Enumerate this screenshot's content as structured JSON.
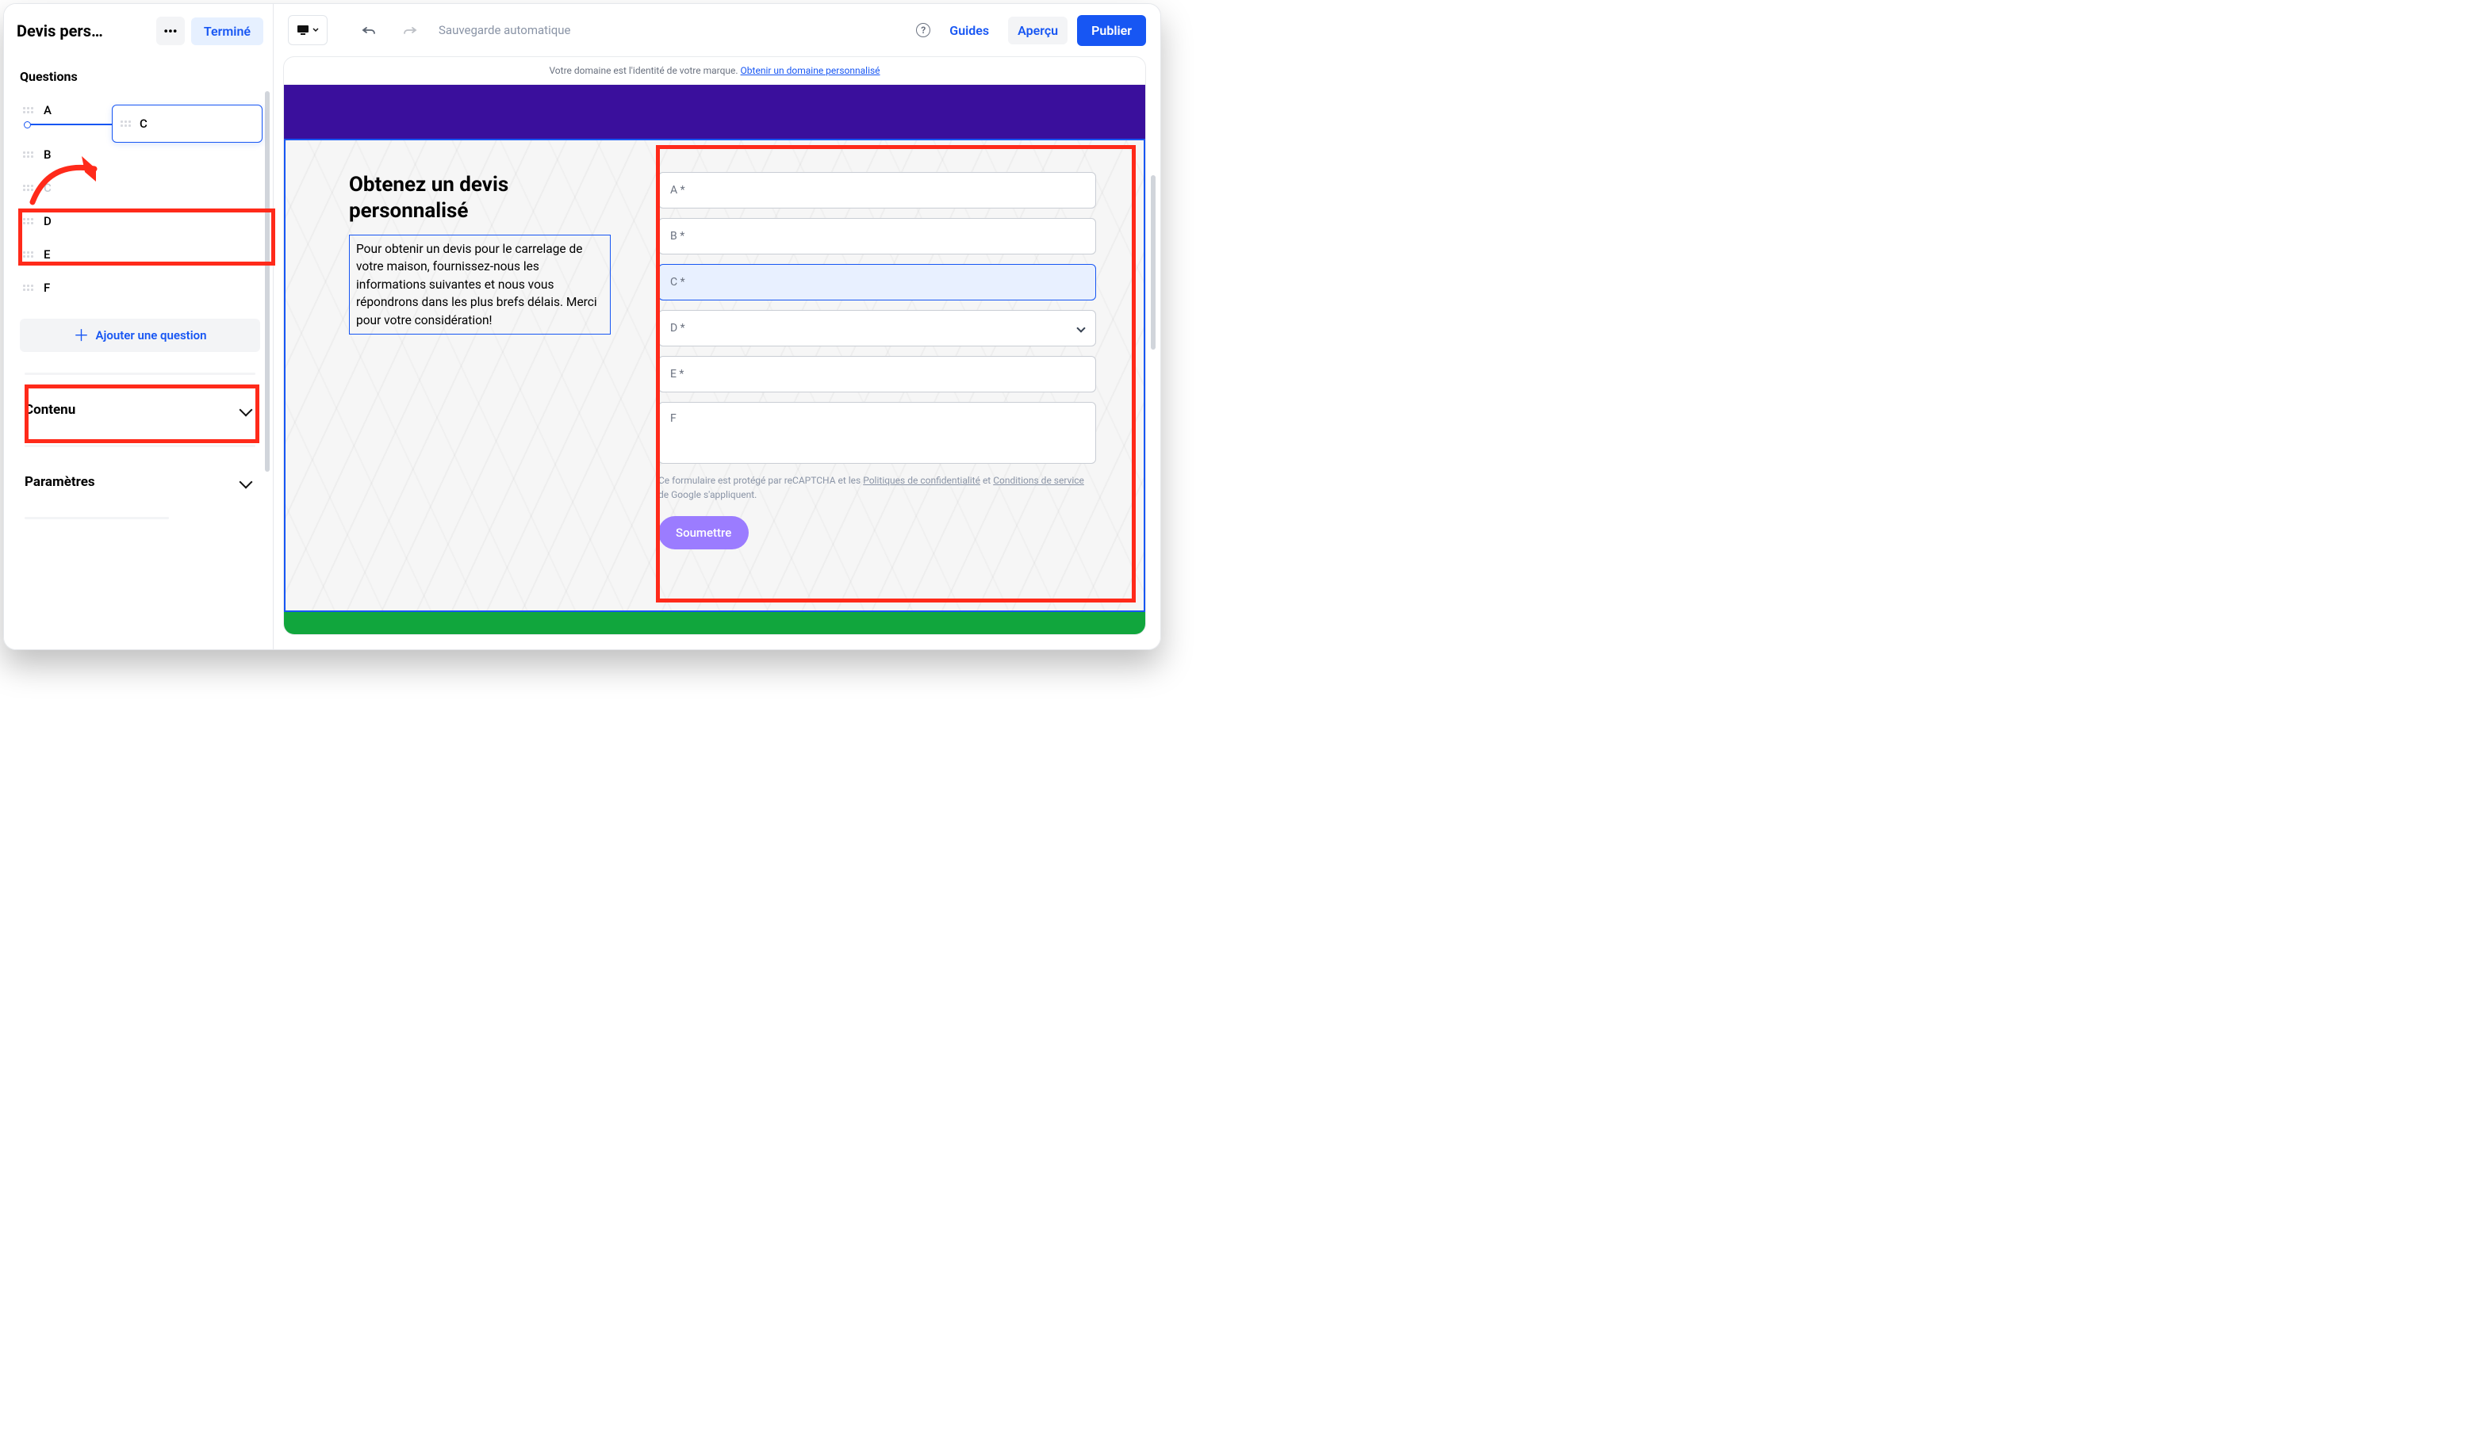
{
  "sidebar": {
    "title": "Devis pers…",
    "done": "Terminé",
    "questions_heading": "Questions",
    "questions": [
      {
        "label": "A"
      },
      {
        "label": "B"
      },
      {
        "label": "C",
        "ghost": true
      },
      {
        "label": "D"
      },
      {
        "label": "E"
      },
      {
        "label": "F"
      }
    ],
    "dragging_label": "C",
    "add_button": "Ajouter une question",
    "accordion_contenu": "Contenu",
    "accordion_parametres": "Paramètres"
  },
  "toolbar": {
    "autosave": "Sauvegarde automatique",
    "guides": "Guides",
    "preview": "Aperçu",
    "publish": "Publier"
  },
  "canvas": {
    "domain_notice": "Votre domaine est l'identité de votre marque. ",
    "domain_link": "Obtenir un domaine personnalisé"
  },
  "form": {
    "title": "Obtenez un devis personnalisé",
    "description": "Pour obtenir un devis pour le carrelage de votre maison, fournissez-nous les informations suivantes et nous vous répondrons dans les plus brefs délais. Merci pour votre considération!",
    "fields": {
      "a": "A *",
      "b": "B *",
      "c": "C *",
      "d": "D *",
      "e": "E *",
      "f": "F"
    },
    "recaptcha_pre": "Ce formulaire est protégé par reCAPTCHA et les ",
    "recaptcha_privacy": "Politiques de confidentialité",
    "recaptcha_mid": " et ",
    "recaptcha_terms": "Conditions de service",
    "recaptcha_post": " de Google s'appliquent.",
    "submit": "Soumettre"
  }
}
